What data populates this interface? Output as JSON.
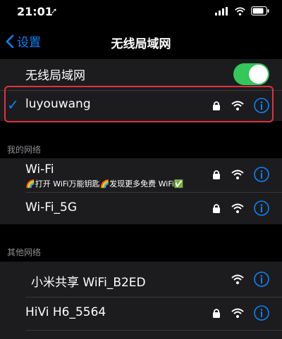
{
  "status_bar": {
    "time": "21:01",
    "location_glyph": "➚"
  },
  "nav": {
    "back_label": "设置",
    "title": "无线局域网"
  },
  "wifi_toggle": {
    "label": "无线局域网",
    "on": true
  },
  "connected": {
    "checkmark": "✓",
    "name": "luyouwang"
  },
  "my_networks": {
    "header": "我的网络",
    "items": [
      {
        "name": "Wi-Fi",
        "subtitle": "🌈打开 WiFi万能钥匙🌈发现更多免费 WiFi✅"
      },
      {
        "name": "Wi-Fi_5G"
      }
    ]
  },
  "other_networks": {
    "header": "其他网络",
    "items": [
      {
        "name": "小米共享 WiFi_B2ED"
      },
      {
        "name": "HiVi H6_5564"
      }
    ]
  },
  "colors": {
    "accent": "#0a84ff",
    "toggle_on": "#34c759",
    "highlight": "#e0323c"
  },
  "icons": [
    "location-arrow-icon",
    "signal-icon",
    "wifi-icon",
    "battery-icon",
    "chevron-left-icon",
    "checkmark-icon",
    "lock-icon",
    "info-icon"
  ]
}
